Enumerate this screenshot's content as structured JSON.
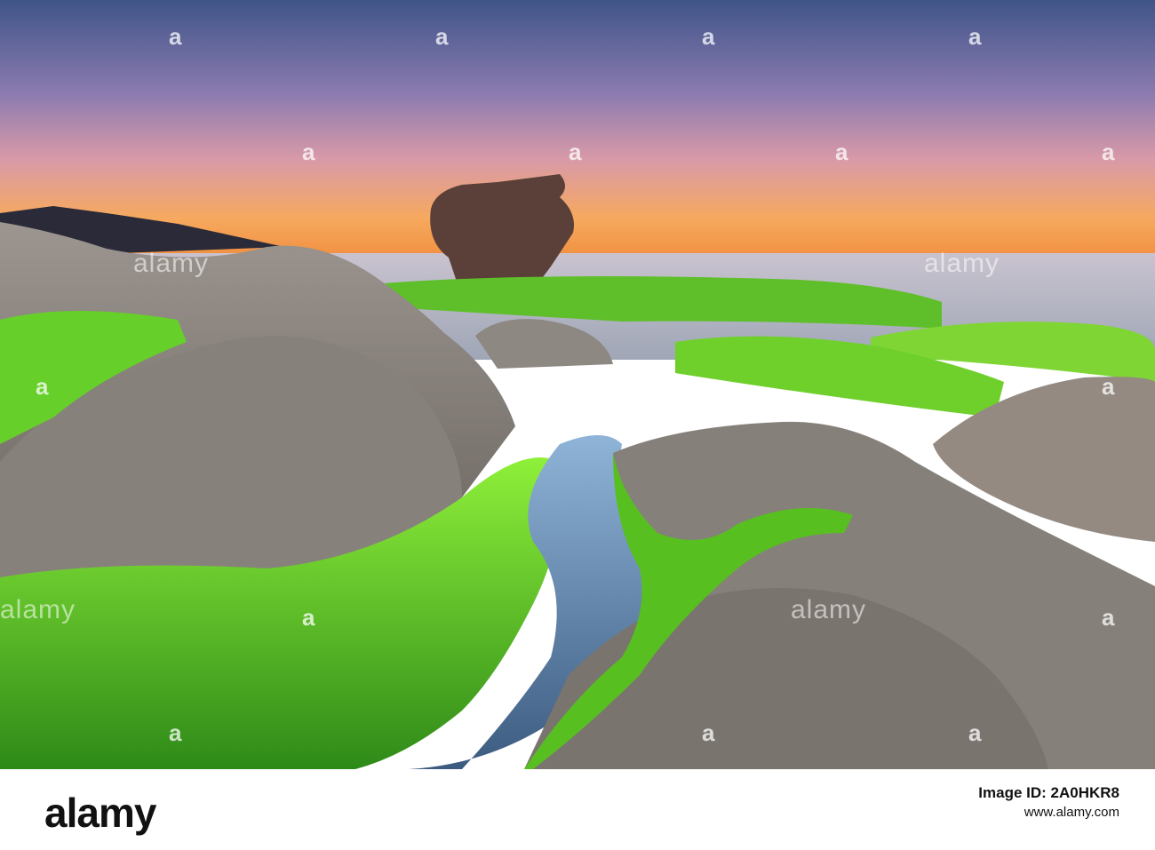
{
  "footer": {
    "logo_text": "alamy",
    "image_id_label": "Image ID: 2A0HKR8",
    "site": "www.alamy.com"
  },
  "watermark": {
    "word": "alamy",
    "glyph": "a"
  },
  "colors": {
    "sky_top": "#4a5b8c",
    "sky_mid": "#c98aa8",
    "horizon": "#f7a54a",
    "moss": "#6fe02a",
    "rock": "#8a8580",
    "water": "#6e8fb8"
  }
}
